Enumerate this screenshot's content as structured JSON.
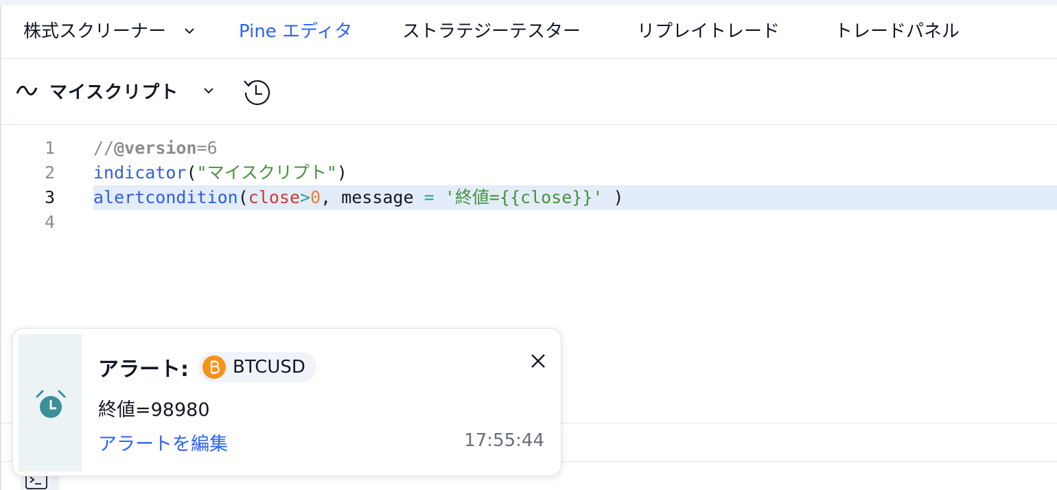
{
  "tabs": [
    {
      "label": "株式スクリーナー",
      "has_dropdown": true,
      "active": false
    },
    {
      "label": "Pine エディタ",
      "active": true
    },
    {
      "label": "ストラテジーテスター",
      "active": false
    },
    {
      "label": "リプレイトレード",
      "active": false
    },
    {
      "label": "トレードパネル",
      "active": false
    }
  ],
  "script": {
    "title": "マイスクリプト"
  },
  "editor": {
    "line_numbers": [
      "1",
      "2",
      "3",
      "4"
    ],
    "highlighted_line": 3,
    "line1": {
      "comment_prefix": "//",
      "directive": "@version",
      "eq": "=",
      "value": "6"
    },
    "line2": {
      "fn": "indicator",
      "open": "(",
      "str": "\"マイスクリプト\"",
      "close": ")"
    },
    "line3": {
      "fn": "alertcondition",
      "open": "(",
      "var": "close",
      "gt": ">",
      "num": "0",
      "comma": ",",
      "param": " message ",
      "assign": "=",
      "str": " '終値={{close}}'",
      "close": " )"
    }
  },
  "alert": {
    "title": "アラート:",
    "symbol": "BTCUSD",
    "message": "終値=98980",
    "edit_link": "アラートを編集",
    "time": "17:55:44"
  },
  "colors": {
    "accent": "#2962ff",
    "alarm_icon": "#3a8f9a",
    "btc": "#f7931a",
    "highlight": "#e3edf9"
  },
  "icons": {
    "dropdown": "chevron-down-icon",
    "script": "wave-icon",
    "history": "history-icon",
    "alarm": "alarm-clock-icon",
    "coin": "bitcoin-icon",
    "close": "close-icon",
    "console": "terminal-icon"
  }
}
